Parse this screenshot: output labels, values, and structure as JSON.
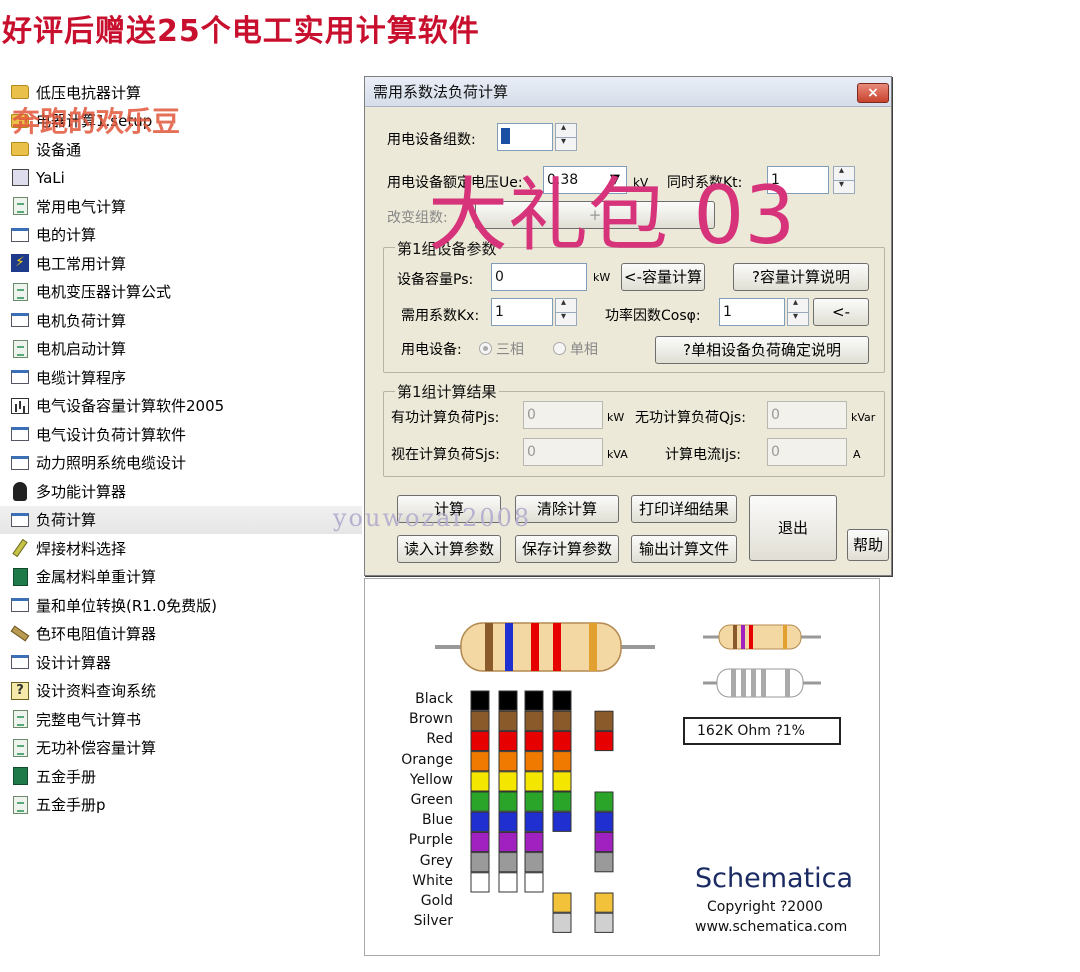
{
  "headline": "好评后赠送25个电工实用计算软件",
  "watermark_text": "奔跑的欢乐豆",
  "overlay_text": "大礼包 03",
  "overlay_watermark": "youwozai2008",
  "sidebar": {
    "items": [
      {
        "label": "低压电抗器计算",
        "icon": "folder-icon"
      },
      {
        "label": "电器计算1.setup",
        "icon": "folder-icon"
      },
      {
        "label": "设备通",
        "icon": "folder-icon"
      },
      {
        "label": "YaLi",
        "icon": "gauge-icon"
      },
      {
        "label": "常用电气计算",
        "icon": "document-icon"
      },
      {
        "label": "电的计算",
        "icon": "window-icon"
      },
      {
        "label": "电工常用计算",
        "icon": "bolt-icon"
      },
      {
        "label": "电机变压器计算公式",
        "icon": "document-icon"
      },
      {
        "label": "电机负荷计算",
        "icon": "window-icon"
      },
      {
        "label": "电机启动计算",
        "icon": "document-icon"
      },
      {
        "label": "电缆计算程序",
        "icon": "window-icon"
      },
      {
        "label": "电气设备容量计算软件2005",
        "icon": "chart-icon"
      },
      {
        "label": "电气设计负荷计算软件",
        "icon": "window-icon"
      },
      {
        "label": "动力照明系统电缆设计",
        "icon": "window-icon"
      },
      {
        "label": "多功能计算器",
        "icon": "figure-icon"
      },
      {
        "label": "负荷计算",
        "icon": "window-icon",
        "selected": true
      },
      {
        "label": "焊接材料选择",
        "icon": "pencil-icon"
      },
      {
        "label": "金属材料单重计算",
        "icon": "book-icon"
      },
      {
        "label": "量和单位转换(R1.0免费版)",
        "icon": "window-icon"
      },
      {
        "label": "色环电阻值计算器",
        "icon": "pen-icon"
      },
      {
        "label": "设计计算器",
        "icon": "window-icon"
      },
      {
        "label": "设计资料查询系统",
        "icon": "help-icon"
      },
      {
        "label": "完整电气计算书",
        "icon": "document-icon"
      },
      {
        "label": "无功补偿容量计算",
        "icon": "document-icon"
      },
      {
        "label": "五金手册",
        "icon": "book-icon"
      },
      {
        "label": "五金手册p",
        "icon": "document-icon"
      }
    ]
  },
  "dialog": {
    "title": "需用系数法负荷计算",
    "close_label": "×",
    "group_count_label": "用电设备组数:",
    "group_count_value": "1",
    "voltage_label": "用电设备额定电压Ue:",
    "voltage_value": "0.38",
    "voltage_unit": "kV",
    "simult_label": "同时系数Kt:",
    "simult_value": "1",
    "change_group_label": "改变组数:",
    "change_group_btn": "+",
    "group1_title": "第1组设备参数",
    "capacity_label": "设备容量Ps:",
    "capacity_value": "0",
    "capacity_unit": "kW",
    "capacity_calc_btn": "<-容量计算",
    "capacity_help_btn": "?容量计算说明",
    "demand_label": "需用系数Kx:",
    "demand_value": "1",
    "pf_label": "功率因数Cosφ:",
    "pf_value": "1",
    "pf_btn": "<-",
    "equipment_label": "用电设备:",
    "three_phase": "三相",
    "single_phase": "单相",
    "single_phase_help_btn": "?单相设备负荷确定说明",
    "result_title": "第1组计算结果",
    "pjs_label": "有功计算负荷Pjs:",
    "pjs_value": "0",
    "pjs_unit": "kW",
    "qjs_label": "无功计算负荷Qjs:",
    "qjs_value": "0",
    "qjs_unit": "kVar",
    "sjs_label": "视在计算负荷Sjs:",
    "sjs_value": "0",
    "sjs_unit": "kVA",
    "ijs_label": "计算电流Ijs:",
    "ijs_value": "0",
    "ijs_unit": "A",
    "btn_calc": "计算",
    "btn_clear": "清除计算",
    "btn_print": "打印详细结果",
    "btn_exit": "退出",
    "btn_load": "读入计算参数",
    "btn_save": "保存计算参数",
    "btn_export": "输出计算文件",
    "btn_help": "帮助"
  },
  "resistor": {
    "color_names": [
      "Black",
      "Brown",
      "Red",
      "Orange",
      "Yellow",
      "Green",
      "Blue",
      "Purple",
      "Grey",
      "White",
      "Gold",
      "Silver"
    ],
    "swatch_colors": {
      "Black": "#000000",
      "Brown": "#8b5a2b",
      "Red": "#e60000",
      "Orange": "#f07a00",
      "Yellow": "#f5e600",
      "Green": "#2aa52a",
      "Blue": "#1f2fd0",
      "Purple": "#a020c0",
      "Grey": "#9a9a9a",
      "White": "#ffffff",
      "Gold": "#f2c23a",
      "Silver": "#d0d0d0"
    },
    "readout": "162K Ohm  ?1%",
    "brand": "Schematica",
    "copyright": "Copyright ?2000",
    "website": "www.schematica.com"
  }
}
